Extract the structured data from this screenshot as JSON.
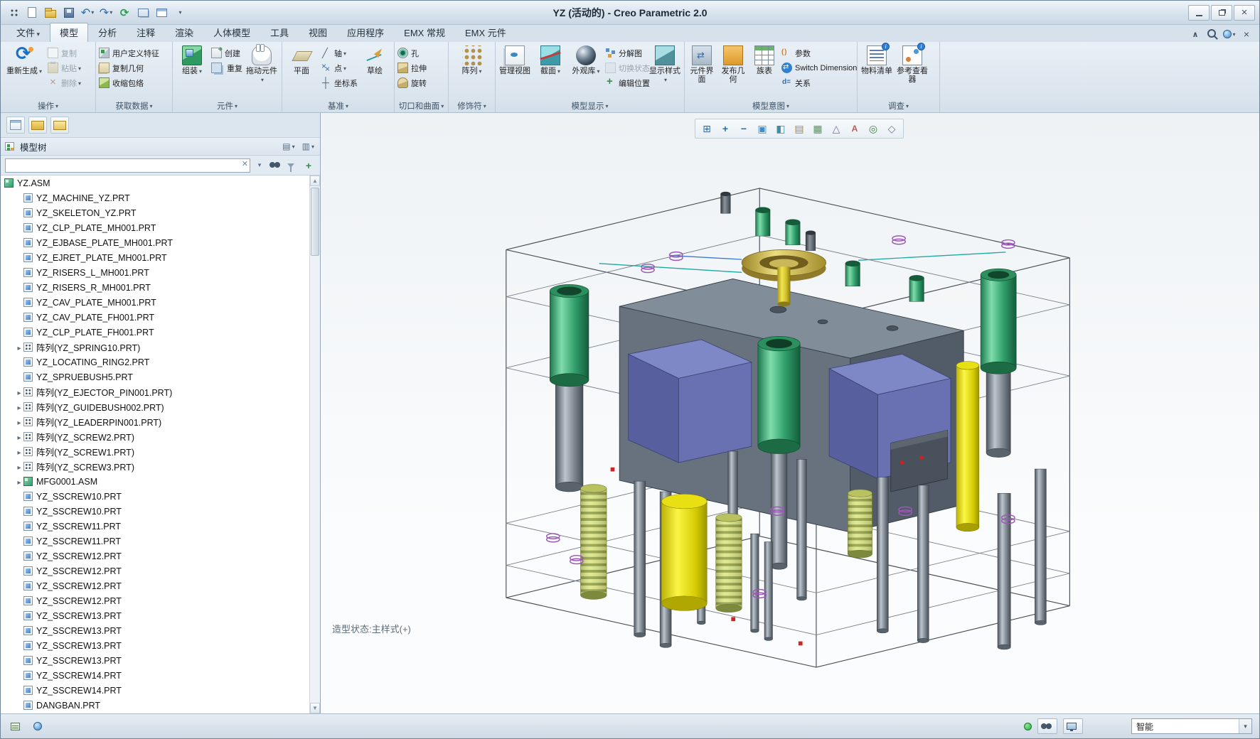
{
  "window": {
    "title": "YZ (活动的) - Creo Parametric 2.0"
  },
  "quick_access": [
    {
      "name": "app-menu-icon"
    },
    {
      "name": "new-file-icon"
    },
    {
      "name": "open-file-icon"
    },
    {
      "name": "save-icon"
    },
    {
      "name": "undo-icon",
      "dropdown": true
    },
    {
      "name": "redo-icon",
      "dropdown": true
    },
    {
      "name": "regenerate-small-icon"
    },
    {
      "name": "window-cascade-icon"
    },
    {
      "name": "new-window-icon"
    },
    {
      "name": "customize-quick-access-icon",
      "dropdown": true
    }
  ],
  "ribbon": {
    "tabs": [
      {
        "label": "文件",
        "dropdown": true
      },
      {
        "label": "模型",
        "active": true
      },
      {
        "label": "分析"
      },
      {
        "label": "注释"
      },
      {
        "label": "渲染"
      },
      {
        "label": "人体模型"
      },
      {
        "label": "工具"
      },
      {
        "label": "视图"
      },
      {
        "label": "应用程序"
      },
      {
        "label": "EMX 常规"
      },
      {
        "label": "EMX 元件"
      }
    ],
    "tab_extras": [
      {
        "name": "collapse-ribbon-icon"
      },
      {
        "name": "ribbon-search-icon"
      },
      {
        "name": "resource-options-icon",
        "dropdown": true
      },
      {
        "name": "close-ribbon-icon"
      }
    ],
    "groups": {
      "operations": {
        "label": "操作",
        "regenerate": "重新生成",
        "copy": "复制",
        "paste": "粘贴",
        "del": "删除"
      },
      "get_data": {
        "label": "获取数据",
        "udf": "用户定义特征",
        "copy_geometry": "复制几何",
        "shrinkwrap": "收缩包络"
      },
      "component": {
        "label": "元件",
        "assemble": "组装",
        "create": "创建",
        "repeat": "重复",
        "drag": "拖动元件"
      },
      "datum": {
        "label": "基准",
        "plane": "平面",
        "axis": "轴",
        "point": "点",
        "csys": "坐标系",
        "sketch": "草绘"
      },
      "cuts": {
        "label": "切口和曲面",
        "hole": "孔",
        "extrude": "拉伸",
        "revolve": "旋转"
      },
      "modifiers": {
        "label": "修饰符",
        "pattern": "阵列"
      },
      "model_display": {
        "label": "模型显示",
        "manage_views": "管理视图",
        "sections": "截面",
        "appearances": "外观库",
        "explode": "分解图",
        "switch_state": "切换状态",
        "edit_position": "编辑位置",
        "display_style": "显示样式"
      },
      "model_intent": {
        "label": "模型意图",
        "component_interface": "元件界面",
        "publish_geometry": "发布几何",
        "family_table": "族表",
        "parameters": "参数",
        "switch_dimensions": "Switch Dimensions",
        "relations": "关系"
      },
      "investigate": {
        "label": "调查",
        "bom": "物料清单",
        "reference_viewer": "参考查看器"
      }
    }
  },
  "panel_toolbar": [
    {
      "name": "navigator-show-icon"
    },
    {
      "name": "folder-browser-icon"
    },
    {
      "name": "favorites-icon"
    }
  ],
  "model_tree": {
    "title": "模型树",
    "search_value": "",
    "items": [
      {
        "label": "YZ.ASM",
        "type": "asm",
        "indent": 0
      },
      {
        "label": "YZ_MACHINE_YZ.PRT",
        "type": "prt",
        "indent": 1
      },
      {
        "label": "YZ_SKELETON_YZ.PRT",
        "type": "prt",
        "indent": 1
      },
      {
        "label": "YZ_CLP_PLATE_MH001.PRT",
        "type": "prt",
        "indent": 1
      },
      {
        "label": "YZ_EJBASE_PLATE_MH001.PRT",
        "type": "prt",
        "indent": 1
      },
      {
        "label": "YZ_EJRET_PLATE_MH001.PRT",
        "type": "prt",
        "indent": 1
      },
      {
        "label": "YZ_RISERS_L_MH001.PRT",
        "type": "prt",
        "indent": 1
      },
      {
        "label": "YZ_RISERS_R_MH001.PRT",
        "type": "prt",
        "indent": 1
      },
      {
        "label": "YZ_CAV_PLATE_MH001.PRT",
        "type": "prt",
        "indent": 1
      },
      {
        "label": "YZ_CAV_PLATE_FH001.PRT",
        "type": "prt",
        "indent": 1
      },
      {
        "label": "YZ_CLP_PLATE_FH001.PRT",
        "type": "prt",
        "indent": 1
      },
      {
        "label": "阵列(YZ_SPRING10.PRT)",
        "type": "pattern",
        "indent": 1,
        "expandable": true
      },
      {
        "label": "YZ_LOCATING_RING2.PRT",
        "type": "prt",
        "indent": 1
      },
      {
        "label": "YZ_SPRUEBUSH5.PRT",
        "type": "prt",
        "indent": 1
      },
      {
        "label": "阵列(YZ_EJECTOR_PIN001.PRT)",
        "type": "pattern",
        "indent": 1,
        "expandable": true
      },
      {
        "label": "阵列(YZ_GUIDEBUSH002.PRT)",
        "type": "pattern",
        "indent": 1,
        "expandable": true
      },
      {
        "label": "阵列(YZ_LEADERPIN001.PRT)",
        "type": "pattern",
        "indent": 1,
        "expandable": true
      },
      {
        "label": "阵列(YZ_SCREW2.PRT)",
        "type": "pattern",
        "indent": 1,
        "expandable": true
      },
      {
        "label": "阵列(YZ_SCREW1.PRT)",
        "type": "pattern",
        "indent": 1,
        "expandable": true
      },
      {
        "label": "阵列(YZ_SCREW3.PRT)",
        "type": "pattern",
        "indent": 1,
        "expandable": true
      },
      {
        "label": "MFG0001.ASM",
        "type": "asm",
        "indent": 1,
        "expandable": true
      },
      {
        "label": "YZ_SSCREW10.PRT",
        "type": "prt",
        "indent": 1
      },
      {
        "label": "YZ_SSCREW10.PRT",
        "type": "prt",
        "indent": 1
      },
      {
        "label": "YZ_SSCREW11.PRT",
        "type": "prt",
        "indent": 1
      },
      {
        "label": "YZ_SSCREW11.PRT",
        "type": "prt",
        "indent": 1
      },
      {
        "label": "YZ_SSCREW12.PRT",
        "type": "prt",
        "indent": 1
      },
      {
        "label": "YZ_SSCREW12.PRT",
        "type": "prt",
        "indent": 1
      },
      {
        "label": "YZ_SSCREW12.PRT",
        "type": "prt",
        "indent": 1
      },
      {
        "label": "YZ_SSCREW12.PRT",
        "type": "prt",
        "indent": 1
      },
      {
        "label": "YZ_SSCREW13.PRT",
        "type": "prt",
        "indent": 1
      },
      {
        "label": "YZ_SSCREW13.PRT",
        "type": "prt",
        "indent": 1
      },
      {
        "label": "YZ_SSCREW13.PRT",
        "type": "prt",
        "indent": 1
      },
      {
        "label": "YZ_SSCREW13.PRT",
        "type": "prt",
        "indent": 1
      },
      {
        "label": "YZ_SSCREW14.PRT",
        "type": "prt",
        "indent": 1
      },
      {
        "label": "YZ_SSCREW14.PRT",
        "type": "prt",
        "indent": 1
      },
      {
        "label": "DANGBAN.PRT",
        "type": "prt",
        "indent": 1
      }
    ]
  },
  "graphics": {
    "status_text": "造型状态:主样式(+)",
    "toolbar": [
      {
        "name": "zoom-fit-icon",
        "glyph": "⊞"
      },
      {
        "name": "zoom-in-icon",
        "glyph": "+"
      },
      {
        "name": "zoom-out-icon",
        "glyph": "−"
      },
      {
        "name": "repaint-icon",
        "glyph": "▣"
      },
      {
        "name": "shading-style-icon",
        "glyph": "◧"
      },
      {
        "name": "saved-orientations-icon",
        "glyph": "▤"
      },
      {
        "name": "view-manager-icon",
        "glyph": "▦"
      },
      {
        "name": "datum-display-icon",
        "glyph": "△"
      },
      {
        "name": "annotations-display-icon",
        "glyph": "A"
      },
      {
        "name": "spin-center-icon",
        "glyph": "◎"
      },
      {
        "name": "perspective-icon",
        "glyph": "◇"
      }
    ]
  },
  "status_bar": {
    "selection_filter": "智能"
  }
}
